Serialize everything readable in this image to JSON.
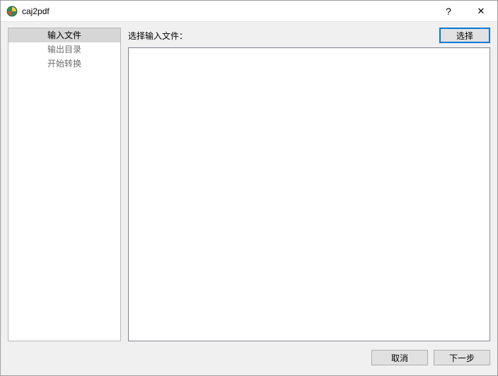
{
  "window": {
    "title": "caj2pdf"
  },
  "titlebar": {
    "help": "?",
    "close": "✕"
  },
  "sidebar": {
    "items": [
      {
        "label": "输入文件",
        "active": true
      },
      {
        "label": "输出目录",
        "active": false
      },
      {
        "label": "开始转换",
        "active": false
      }
    ]
  },
  "content": {
    "select_label": "选择输入文件：",
    "select_button": "选择"
  },
  "footer": {
    "cancel": "取消",
    "next": "下一步"
  },
  "icons": {
    "app": "app-icon"
  }
}
